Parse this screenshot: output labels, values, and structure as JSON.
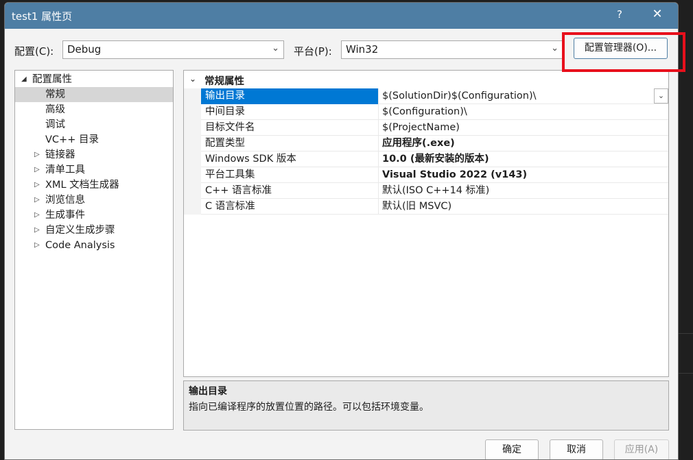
{
  "window": {
    "title": "test1 属性页",
    "help_label": "?",
    "close_label": "✕"
  },
  "toolbar": {
    "config_label": "配置(C):",
    "config_value": "Debug",
    "platform_label": "平台(P):",
    "platform_value": "Win32",
    "config_manager_label": "配置管理器(O)...",
    "highlight_color": "#e8101c"
  },
  "tree": {
    "root_label": "配置属性",
    "items": [
      {
        "label": "常规",
        "selected": true,
        "expandable": false
      },
      {
        "label": "高级",
        "expandable": false
      },
      {
        "label": "调试",
        "expandable": false
      },
      {
        "label": "VC++ 目录",
        "expandable": false
      },
      {
        "label": "链接器",
        "expandable": true
      },
      {
        "label": "清单工具",
        "expandable": true
      },
      {
        "label": "XML 文档生成器",
        "expandable": true
      },
      {
        "label": "浏览信息",
        "expandable": true
      },
      {
        "label": "生成事件",
        "expandable": true
      },
      {
        "label": "自定义生成步骤",
        "expandable": true
      },
      {
        "label": "Code Analysis",
        "expandable": true
      }
    ]
  },
  "grid": {
    "category": "常规属性",
    "rows": [
      {
        "name": "输出目录",
        "value": "$(SolutionDir)$(Configuration)\\",
        "selected": true,
        "bold": false
      },
      {
        "name": "中间目录",
        "value": "$(Configuration)\\",
        "bold": false
      },
      {
        "name": "目标文件名",
        "value": "$(ProjectName)",
        "bold": false
      },
      {
        "name": "配置类型",
        "value": "应用程序(.exe)",
        "bold": true
      },
      {
        "name": "Windows SDK 版本",
        "value": "10.0 (最新安装的版本)",
        "bold": true
      },
      {
        "name": "平台工具集",
        "value": "Visual Studio 2022 (v143)",
        "bold": true
      },
      {
        "name": "C++ 语言标准",
        "value": "默认(ISO C++14 标准)",
        "bold": false
      },
      {
        "name": "C 语言标准",
        "value": "默认(旧 MSVC)",
        "bold": false
      }
    ]
  },
  "description": {
    "title": "输出目录",
    "text": "指向已编译程序的放置位置的路径。可以包括环境变量。"
  },
  "buttons": {
    "ok": "确定",
    "cancel": "取消",
    "apply": "应用(A)"
  },
  "colors": {
    "titlebar": "#4e7ea4",
    "selection": "#0078d4"
  }
}
